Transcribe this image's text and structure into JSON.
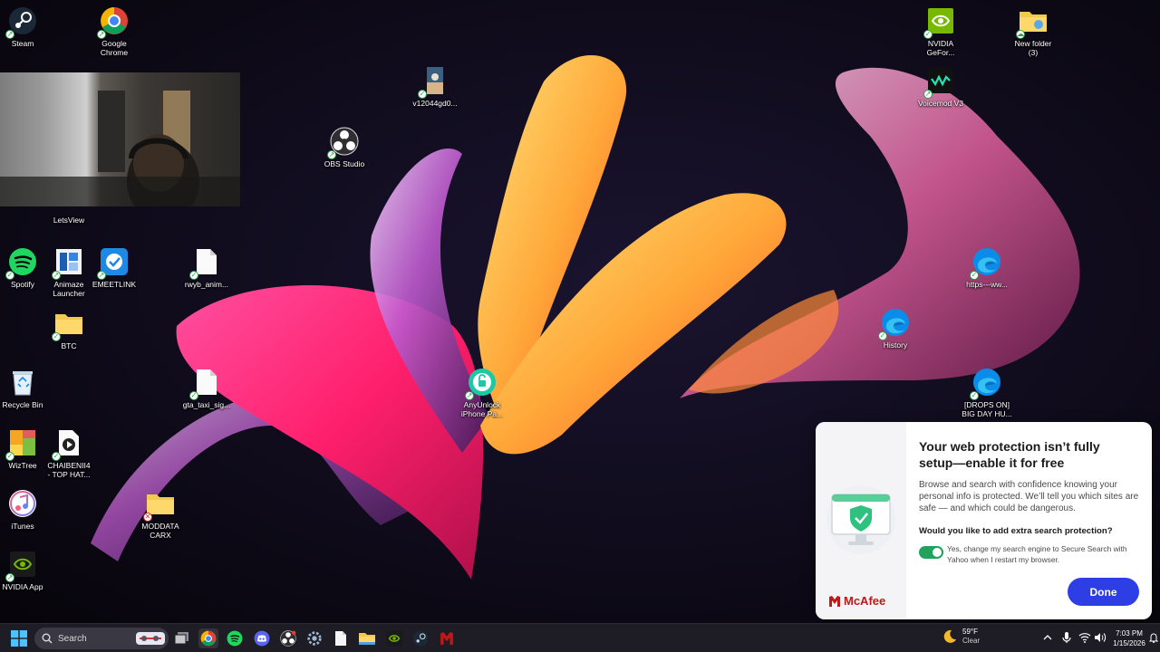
{
  "desktop": {
    "icons": [
      {
        "label": "Steam",
        "icon": "steam-icon"
      },
      {
        "label": "Google\nChrome",
        "icon": "chrome-icon"
      },
      {
        "label": "NVIDIA\nGeFor...",
        "icon": "nvidia-icon"
      },
      {
        "label": "New folder\n(3)",
        "icon": "folder-icon"
      },
      {
        "label": "v12044gd0...",
        "icon": "image-file-icon"
      },
      {
        "label": "Voicemod V3",
        "icon": "voicemod-icon"
      },
      {
        "label": "OBS Studio",
        "icon": "obs-icon"
      },
      {
        "label": "LetsView",
        "icon": "letsview-icon"
      },
      {
        "label": "Spotify",
        "icon": "spotify-icon"
      },
      {
        "label": "Animaze\nLauncher",
        "icon": "animaze-icon"
      },
      {
        "label": "EMEETLINK",
        "icon": "emeetlink-icon"
      },
      {
        "label": "rwyb_anim...",
        "icon": "file-icon"
      },
      {
        "label": "https---ww...",
        "icon": "edge-icon"
      },
      {
        "label": "BTC",
        "icon": "folder-icon"
      },
      {
        "label": "History",
        "icon": "edge-icon"
      },
      {
        "label": "Recycle Bin",
        "icon": "recycle-bin-icon"
      },
      {
        "label": "gta_taxi_sig...",
        "icon": "file-icon"
      },
      {
        "label": "AnyUnlock\niPhone Pa...",
        "icon": "anyunlock-icon"
      },
      {
        "label": "[DROPS ON]\nBIG DAY HU...",
        "icon": "edge-icon"
      },
      {
        "label": "WizTree",
        "icon": "wiztree-icon"
      },
      {
        "label": "CHAIBENII4\n- TOP HAT...",
        "icon": "video-file-icon"
      },
      {
        "label": "MODDATA\nCARX",
        "icon": "folder-icon"
      },
      {
        "label": "iTunes",
        "icon": "itunes-icon"
      },
      {
        "label": "NVIDIA App",
        "icon": "nvidia-icon"
      }
    ]
  },
  "mcafee": {
    "title": "Your web protection isn’t fully setup—enable it for free",
    "description": "Browse and search with confidence knowing your personal info is protected. We’ll tell you which sites are safe — and which could be dangerous.",
    "question": "Would you like to add extra search protection?",
    "toggle_label": "Yes, change my search engine to Secure Search with Yahoo when I restart my browser.",
    "toggle_on": true,
    "done_label": "Done",
    "brand": "McAfee",
    "colors": {
      "accent": "#2d3ee4",
      "toggle": "#21a35c",
      "brand": "#c01818"
    }
  },
  "taskbar": {
    "search_label": "Search",
    "apps": [
      "start-icon",
      "task-view-icon",
      "chrome-icon",
      "spotify-icon",
      "discord-icon",
      "obs-icon",
      "settings-icon",
      "notepad-icon",
      "file-explorer-icon",
      "nvidia-icon",
      "steam-icon",
      "mcafee-icon"
    ],
    "weather": {
      "temp": "59°F",
      "condition": "Clear"
    },
    "clock": {
      "time": "7:03 PM",
      "date": "1/15/2026"
    }
  }
}
